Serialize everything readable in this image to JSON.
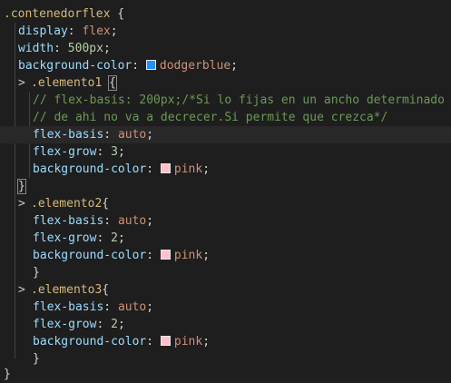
{
  "code": {
    "rule_main": {
      "selector": ".contenedorflex",
      "open": " {",
      "decls": [
        {
          "prop": "display",
          "value": "flex"
        },
        {
          "prop": "width",
          "value": "500px"
        },
        {
          "prop": "background-color",
          "value": "dodgerblue",
          "swatch": "#1e90ff"
        }
      ]
    },
    "rule1": {
      "selector": ".elemento1",
      "open": "{",
      "comment1": "// flex-basis: 200px;/*Si lo fijas en un ancho determinado",
      "comment2": "// de ahi no va a decrecer.Si permite que crezca*/",
      "decls": [
        {
          "prop": "flex-basis",
          "value": "auto"
        },
        {
          "prop": "flex-grow",
          "value": "3"
        },
        {
          "prop": "background-color",
          "value": "pink",
          "swatch": "#ffc0cb"
        }
      ],
      "close": "}"
    },
    "rule2": {
      "selector": ".elemento2",
      "open": "{",
      "decls": [
        {
          "prop": "flex-basis",
          "value": "auto"
        },
        {
          "prop": "flex-grow",
          "value": "2"
        },
        {
          "prop": "background-color",
          "value": "pink",
          "swatch": "#ffc0cb"
        }
      ],
      "close": "}"
    },
    "rule3": {
      "selector": ".elemento3",
      "open": "{",
      "decls": [
        {
          "prop": "flex-basis",
          "value": "auto"
        },
        {
          "prop": "flex-grow",
          "value": "2"
        },
        {
          "prop": "background-color",
          "value": "pink",
          "swatch": "#ffc0cb"
        }
      ],
      "close": "}"
    },
    "main_close": "}",
    "colon": ": ",
    "semicolon": ";",
    "chevron": ">"
  },
  "theme": {
    "background": "#1e1e1e",
    "selector_color": "#d7ba7d",
    "property_color": "#9cdcfe",
    "value_color": "#ce9178",
    "number_color": "#b5cea8",
    "comment_color": "#6a9955"
  }
}
